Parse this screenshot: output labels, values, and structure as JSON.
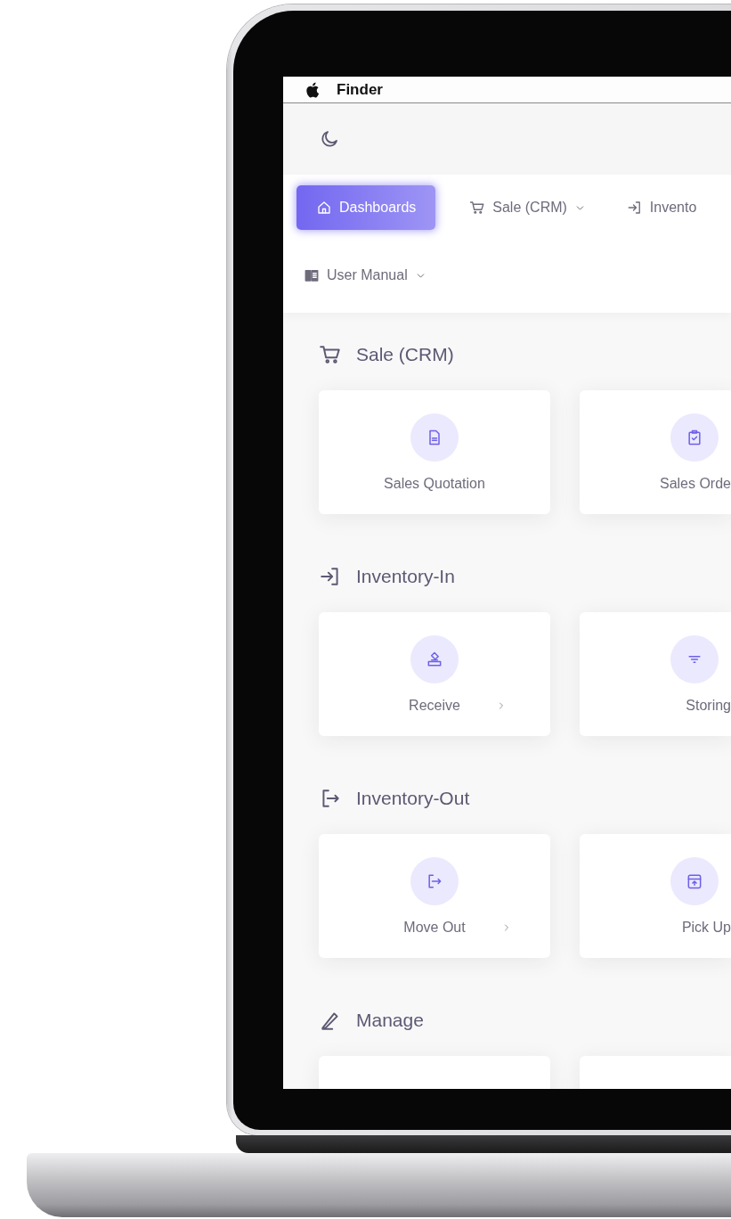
{
  "menu_bar": {
    "app_name": "Finder"
  },
  "nav": {
    "rows": [
      [
        {
          "label": "Dashboards",
          "selected": true,
          "dropdown": false
        },
        {
          "label": "Sale (CRM)",
          "selected": false,
          "dropdown": true
        },
        {
          "label": "Invento",
          "selected": false,
          "dropdown": false
        }
      ],
      [
        {
          "label": "User Manual",
          "selected": false,
          "dropdown": true
        }
      ]
    ]
  },
  "sections": [
    {
      "title": "Sale (CRM)",
      "cards": [
        {
          "label": "Sales Quotation",
          "chevron": false
        },
        {
          "label": "Sales Orde",
          "chevron": false
        }
      ]
    },
    {
      "title": "Inventory-In",
      "cards": [
        {
          "label": "Receive",
          "chevron": true
        },
        {
          "label": "Storing",
          "chevron": false
        }
      ]
    },
    {
      "title": "Inventory-Out",
      "cards": [
        {
          "label": "Move Out",
          "chevron": true
        },
        {
          "label": "Pick Up",
          "chevron": false
        }
      ]
    },
    {
      "title": "Manage",
      "cards": [
        {
          "chevron": false
        },
        {
          "chevron": false
        }
      ]
    }
  ]
}
